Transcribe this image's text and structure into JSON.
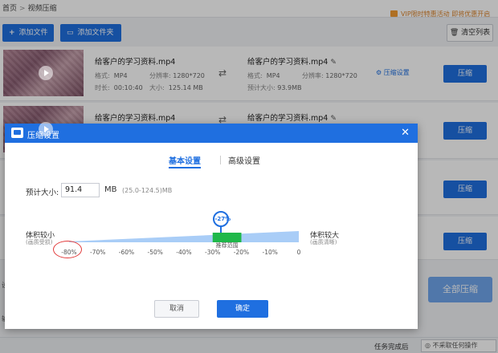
{
  "breadcrumb": {
    "home": "首页",
    "separator": ">",
    "current": "视频压缩"
  },
  "promo": {
    "text": "VIP限时特惠活动   即将优惠开启"
  },
  "toolbar": {
    "add_file": "添加文件",
    "add_folder": "添加文件夹",
    "clear_list": "清空列表"
  },
  "files": [
    {
      "name": "给客户的学习资料.mp4",
      "format_label": "格式:",
      "format": "MP4",
      "resolution_label": "分辨率:",
      "resolution": "1280*720",
      "duration_label": "时长:",
      "duration": "00:10:40",
      "size_label": "大小:",
      "size": "125.14 MB",
      "output_name": "给客户的学习资料.mp4",
      "output_format_label": "格式:",
      "output_format": "MP4",
      "output_resolution_label": "分辨率:",
      "output_resolution": "1280*720",
      "estimated_label": "预计大小:",
      "estimated": "93.9MB",
      "settings_link": "压缩设置",
      "compress_label": "压缩"
    },
    {
      "name": "给客户的学习资料.mp4",
      "output_name": "给客户的学习资料.mp4",
      "compress_label": "压缩"
    },
    {
      "compress_label": "压缩"
    },
    {
      "compress_label": "压缩"
    }
  ],
  "compress_all": "全部压缩",
  "bottom": {
    "after_label": "任务完成后",
    "after_value": "不采取任何操作",
    "side_marks": [
      "设",
      "输"
    ]
  },
  "dialog": {
    "title": "压缩设置",
    "close_icon": "close-icon",
    "tabs": [
      {
        "label": "基本设置",
        "active": true
      },
      {
        "label": "高级设置",
        "active": false
      }
    ],
    "estimated_label": "预计大小:",
    "estimated_value": "91.4",
    "unit": "MB",
    "range": "(25.0-124.5)MB",
    "left_label": "体积较小",
    "left_sub": "(画质受损)",
    "right_label": "体积较大",
    "right_sub": "(画质清晰)",
    "recommended_label": "推荐范围",
    "current_value_label": "-27%",
    "current_value": -27,
    "recommended_range": [
      -30,
      -20
    ],
    "scale_ticks": [
      "-80%",
      "-70%",
      "-60%",
      "-50%",
      "-40%",
      "-30%",
      "-20%",
      "-10%",
      "0"
    ],
    "scale_min": -80,
    "scale_max": 0,
    "cancel_label": "取消",
    "ok_label": "确定"
  },
  "colors": {
    "primary": "#1f6fe0",
    "slider_track": "#a9cdf7",
    "slider_recommended": "#1fb84a",
    "highlight_circle": "#e23b3b",
    "promo": "#d9822b"
  }
}
